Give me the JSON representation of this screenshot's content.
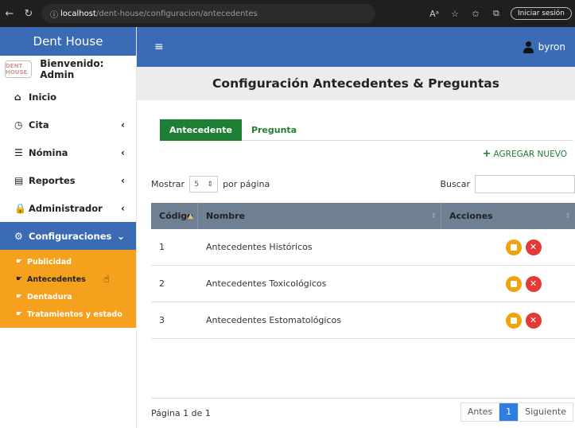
{
  "browser": {
    "url_host": "localhost",
    "url_path": "/dent-house/configuracion/antecedentes",
    "read_aloud": "Aᵃ",
    "login_button": "Iniciar sesión"
  },
  "sidebar": {
    "brand": "Dent House",
    "logo_text": "DENT HOUSE",
    "welcome": "Bienvenido: Admin",
    "items": [
      {
        "label": "Inicio",
        "icon": "home-icon",
        "glyph": "⌂",
        "chevron": ""
      },
      {
        "label": "Cita",
        "icon": "clock-icon",
        "glyph": "◷",
        "chevron": "‹"
      },
      {
        "label": "Nómina",
        "icon": "list-icon",
        "glyph": "☰",
        "chevron": "‹"
      },
      {
        "label": "Reportes",
        "icon": "file-icon",
        "glyph": "▤",
        "chevron": "‹"
      },
      {
        "label": "Administrador",
        "icon": "lock-icon",
        "glyph": "🔒",
        "chevron": "‹"
      },
      {
        "label": "Configuraciones",
        "icon": "gears-icon",
        "glyph": "⚙",
        "chevron": "⌄"
      }
    ],
    "submenu": [
      "Publicidad",
      "Antecedentes",
      "Dentadura",
      "Tratamientos y estado"
    ]
  },
  "header": {
    "user": "byron"
  },
  "page": {
    "title": "Configuración Antecedentes & Preguntas",
    "tabs": [
      "Antecedente",
      "Pregunta"
    ],
    "add_new": "AGREGAR NUEVO",
    "show_label": "Mostrar",
    "per_page_value": "5",
    "per_page_label": "por página",
    "search_label": "Buscar",
    "search_value": ""
  },
  "table": {
    "columns": [
      "Código",
      "Nombre",
      "Acciones"
    ],
    "rows": [
      {
        "codigo": "1",
        "nombre": "Antecedentes Históricos"
      },
      {
        "codigo": "2",
        "nombre": "Antecedentes Toxicológicos"
      },
      {
        "codigo": "3",
        "nombre": "Antecedentes Estomatológicos"
      }
    ]
  },
  "pagination": {
    "info": "Página 1 de 1",
    "prev": "Antes",
    "current": "1",
    "next": "Siguiente"
  },
  "colors": {
    "primary": "#3c6bb5",
    "submenu": "#f5a11d",
    "tab_green": "#1e7e34",
    "edit": "#f0a30a",
    "delete": "#e53935"
  }
}
